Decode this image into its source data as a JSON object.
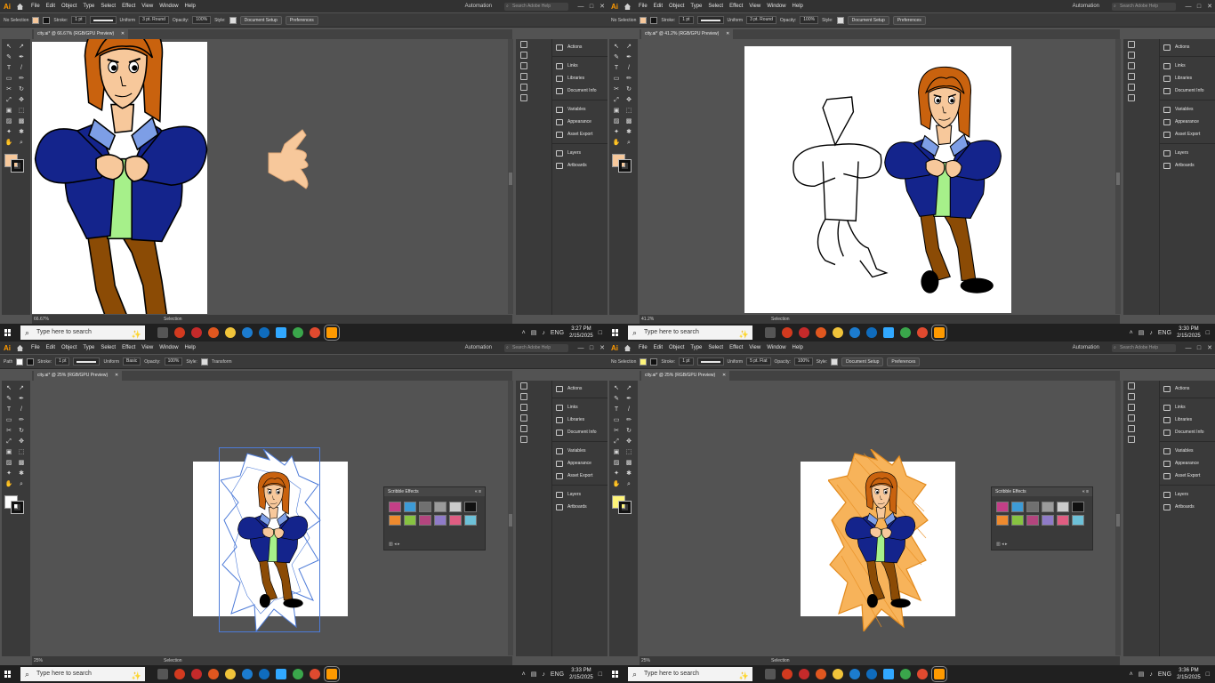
{
  "menu": {
    "logo": "Ai",
    "items": [
      "File",
      "Edit",
      "Object",
      "Type",
      "Select",
      "Effect",
      "View",
      "Window",
      "Help"
    ],
    "automation": "Automation",
    "search_placeholder": "Search Adobe Help",
    "win_minimize": "—",
    "win_maximize": "□",
    "win_close": "✕"
  },
  "panel_items": [
    "Actions",
    "Links",
    "Libraries",
    "Document Info",
    "Variables",
    "Appearance",
    "Asset Export",
    "Layers",
    "Artboards"
  ],
  "scribble_panel": {
    "title": "Scribble Effects",
    "controls": "« ≡",
    "colors": [
      "#c33f87",
      "#3d9bd6",
      "#707070",
      "#9b9b9b",
      "#cccccc",
      "#111111",
      "#ee8a2e",
      "#87c341",
      "#b3457e",
      "#8f7bc8",
      "#e05d82",
      "#6dc1d8"
    ]
  },
  "taskbar": {
    "search_placeholder": "Type here to search",
    "lang": "ENG",
    "app_colors": [
      "#555555",
      "#d23a1f",
      "#c52a2a",
      "#e0571f",
      "#f0c43a",
      "#1c7ccf",
      "#0f6cbd",
      "#31a8ff",
      "#3aa64b",
      "#e04a2f",
      "#ff9a00"
    ]
  },
  "windows": [
    {
      "tab_title": "city.ai* @ 66.67% (RGB/GPU Preview)",
      "zoom": "66.67%",
      "status_text": "Selection",
      "fill_color": "#f7c89b",
      "ctrl": {
        "selection": "No Selection",
        "stroke_label": "Stroke:",
        "stroke_value": "1 pt",
        "profile": "Uniform",
        "brush": "3 pt. Round",
        "opacity_label": "Opacity:",
        "opacity": "100%",
        "style_label": "Style:",
        "doc_setup": "Document Setup",
        "prefs": "Preferences"
      },
      "clock_time": "3:27 PM",
      "clock_date": "2/15/2025"
    },
    {
      "tab_title": "city.ai* @ 41.2% (RGB/GPU Preview)",
      "zoom": "41.2%",
      "status_text": "Selection",
      "fill_color": "#f7c89b",
      "ctrl": {
        "selection": "No Selection",
        "stroke_label": "Stroke:",
        "stroke_value": "1 pt",
        "profile": "Uniform",
        "brush": "3 pt. Round",
        "opacity_label": "Opacity:",
        "opacity": "100%",
        "style_label": "Style:",
        "doc_setup": "Document Setup",
        "prefs": "Preferences"
      },
      "clock_time": "3:30 PM",
      "clock_date": "2/15/2025"
    },
    {
      "tab_title": "city.ai* @ 25% (RGB/GPU Preview)",
      "zoom": "25%",
      "status_text": "Selection",
      "fill_color": "#ffffff",
      "ctrl": {
        "selection": "Path",
        "stroke_label": "Stroke:",
        "stroke_value": "1 pt",
        "profile": "Uniform",
        "brush": "Basic",
        "opacity_label": "Opacity:",
        "opacity": "100%",
        "style_label": "Style:",
        "transform": "Transform"
      },
      "clock_time": "3:33 PM",
      "clock_date": "2/15/2025"
    },
    {
      "tab_title": "city.ai* @ 25% (RGB/GPU Preview)",
      "zoom": "25%",
      "status_text": "Selection",
      "fill_color": "#fff57a",
      "ctrl": {
        "selection": "No Selection",
        "stroke_label": "Stroke:",
        "stroke_value": "1 pt",
        "profile": "Uniform",
        "brush": "5 pt. Flat",
        "opacity_label": "Opacity:",
        "opacity": "100%",
        "style_label": "Style:",
        "doc_setup": "Document Setup",
        "prefs": "Preferences"
      },
      "clock_time": "3:36 PM",
      "clock_date": "2/15/2025"
    }
  ],
  "colors": {
    "skin": "#f7c89b",
    "hair": "#c9620e",
    "jacket": "#14248c",
    "collar": "#7d9ee6",
    "shirt": "#a6f08a",
    "pants": "#8b4b05",
    "shoes": "#000000",
    "scribble": "#f4a43a",
    "selection": "#4d7bd8"
  }
}
